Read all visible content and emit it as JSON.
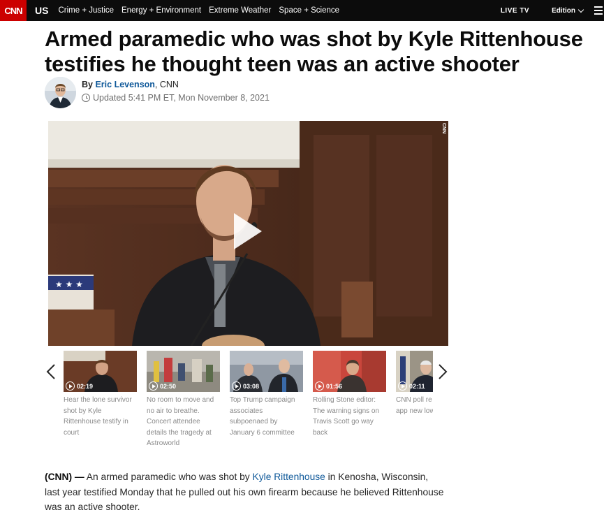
{
  "nav": {
    "logo": "CNN",
    "section": "US",
    "links": [
      "Crime + Justice",
      "Energy + Environment",
      "Extreme Weather",
      "Space + Science"
    ],
    "live_tv": "LIVE TV",
    "edition": "Edition"
  },
  "article": {
    "headline": "Armed paramedic who was shot by Kyle Rittenhouse testifies he thought teen was an active shooter",
    "byline_prefix": "By",
    "author": "Eric Levenson",
    "outlet": ", CNN",
    "updated": "Updated 5:41 PM ET, Mon November 8, 2021"
  },
  "video": {
    "bug": "CNN"
  },
  "carousel": {
    "items": [
      {
        "duration": "02:19",
        "caption": "Hear the lone survivor shot by Kyle Rittenhouse testify in court"
      },
      {
        "duration": "02:50",
        "caption": "No room to move and no air to breathe. Concert attendee details the tragedy at Astroworld"
      },
      {
        "duration": "03:08",
        "caption": "Top Trump campaign associates subpoenaed by January 6 committee"
      },
      {
        "duration": "01:56",
        "caption": "Rolling Stone editor: The warning signs on Travis Scott go way back"
      },
      {
        "duration": "02:11",
        "caption": "CNN poll re Biden's app new low"
      }
    ]
  },
  "body": {
    "dateline": "(CNN) —",
    "text_before_link": " An armed paramedic who was shot by ",
    "link_text": "Kyle Rittenhouse",
    "text_after_link": " in Kenosha, Wisconsin, last year testified Monday that he pulled out his own firearm because he believed Rittenhouse was an active shooter."
  }
}
